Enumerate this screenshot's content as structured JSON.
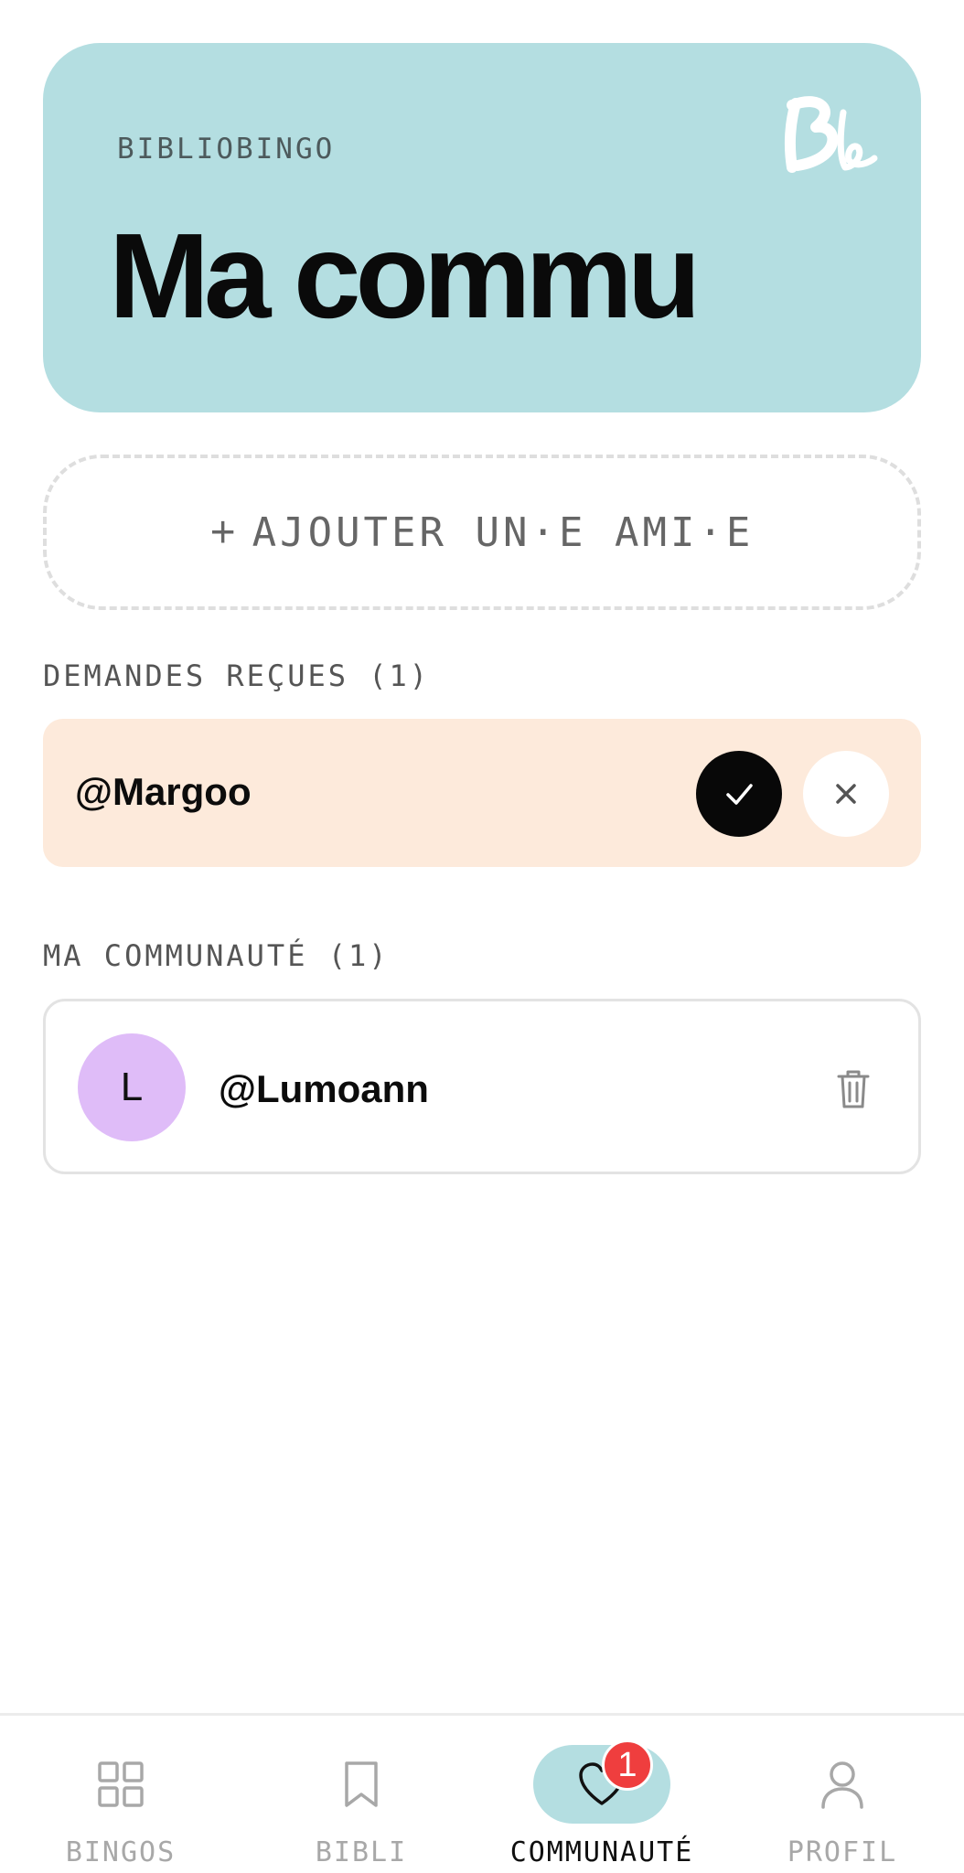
{
  "header": {
    "kicker": "BIBLIOBINGO",
    "title": "Ma commu",
    "logo_text": "Bb"
  },
  "add_friend": {
    "plus": "+",
    "label": "AJOUTER UN·E AMI·E"
  },
  "requests": {
    "section_label": "DEMANDES REÇUES (1)",
    "items": [
      {
        "username": "@Margoo"
      }
    ]
  },
  "community": {
    "section_label": "MA COMMUNAUTÉ (1)",
    "items": [
      {
        "initial": "L",
        "username": "@Lumoann"
      }
    ]
  },
  "nav": {
    "items": [
      {
        "label": "BINGOS",
        "icon": "grid-icon"
      },
      {
        "label": "BIBLI",
        "icon": "bookmark-icon"
      },
      {
        "label": "COMMUNAUTÉ",
        "icon": "heart-icon",
        "active": true,
        "badge": "1"
      },
      {
        "label": "PROFIL",
        "icon": "user-icon"
      }
    ]
  },
  "colors": {
    "hero_bg": "#b4dee1",
    "request_bg": "#fdeadb",
    "avatar_bg": "#dfbcf8",
    "badge_bg": "#ef3e3e"
  }
}
